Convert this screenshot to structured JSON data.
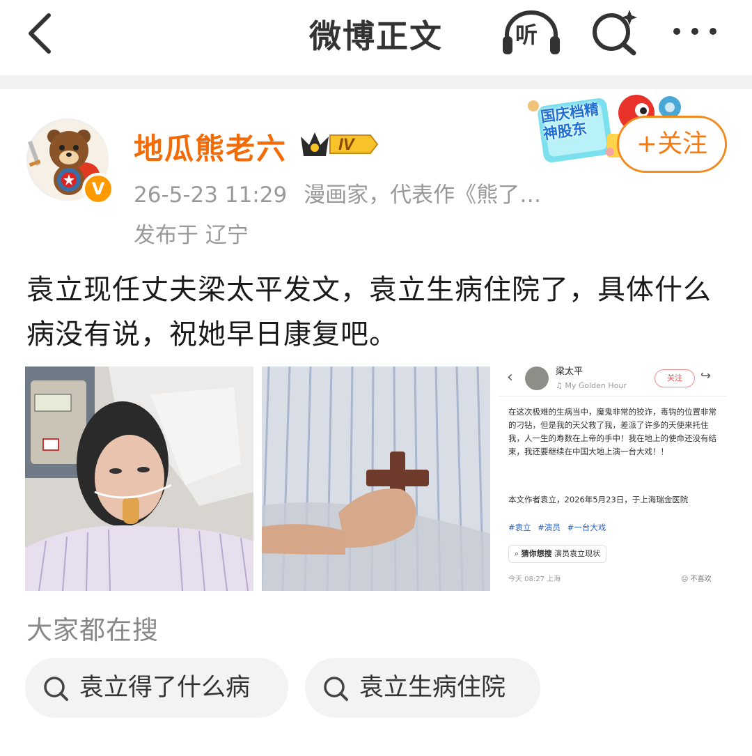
{
  "nav": {
    "title": "微博正文",
    "listen_label": "听"
  },
  "author": {
    "name": "地瓜熊老六",
    "level": "IV",
    "time": "26-5-23 11:29",
    "bio": "漫画家，代表作《熊了…",
    "location": "发布于 辽宁",
    "follow_label": "+关注"
  },
  "promo": {
    "text": "国庆档精神股东"
  },
  "post": {
    "text": "袁立现任丈夫梁太平发文，袁立生病住院了，具体什么病没有说，祝她早日康复吧。"
  },
  "images": {
    "screenshot": {
      "name": "梁太平",
      "song": "♫ My Golden Hour",
      "follow": "关注",
      "body": "在这次极难的生病当中，魔鬼非常的狡诈，毒钩的位置非常的刁钻，但是我的天父救了我，差派了许多的天使来托住我，人一生的寿数在上帝的手中！我在地上的使命还没有结束，我还要继续在中国大地上演一台大戏！！",
      "signature": "本文作者袁立，2026年5月23日，于上海瑞金医院",
      "tags": [
        "#袁立",
        "#演员",
        "#一台大戏"
      ],
      "guess_label": "猜你想搜",
      "guess_value": "演员袁立现状",
      "time": "今天 08:27 上海",
      "dislike": "不喜欢"
    }
  },
  "hot_searches": {
    "title": "大家都在搜",
    "items": [
      "袁立得了什么病",
      "袁立生病住院"
    ]
  },
  "colors": {
    "author_name": "#f26b07",
    "follow_border": "#f28a20",
    "tag_blue": "#2b64c6",
    "chip_bg": "#f3f3f3"
  }
}
